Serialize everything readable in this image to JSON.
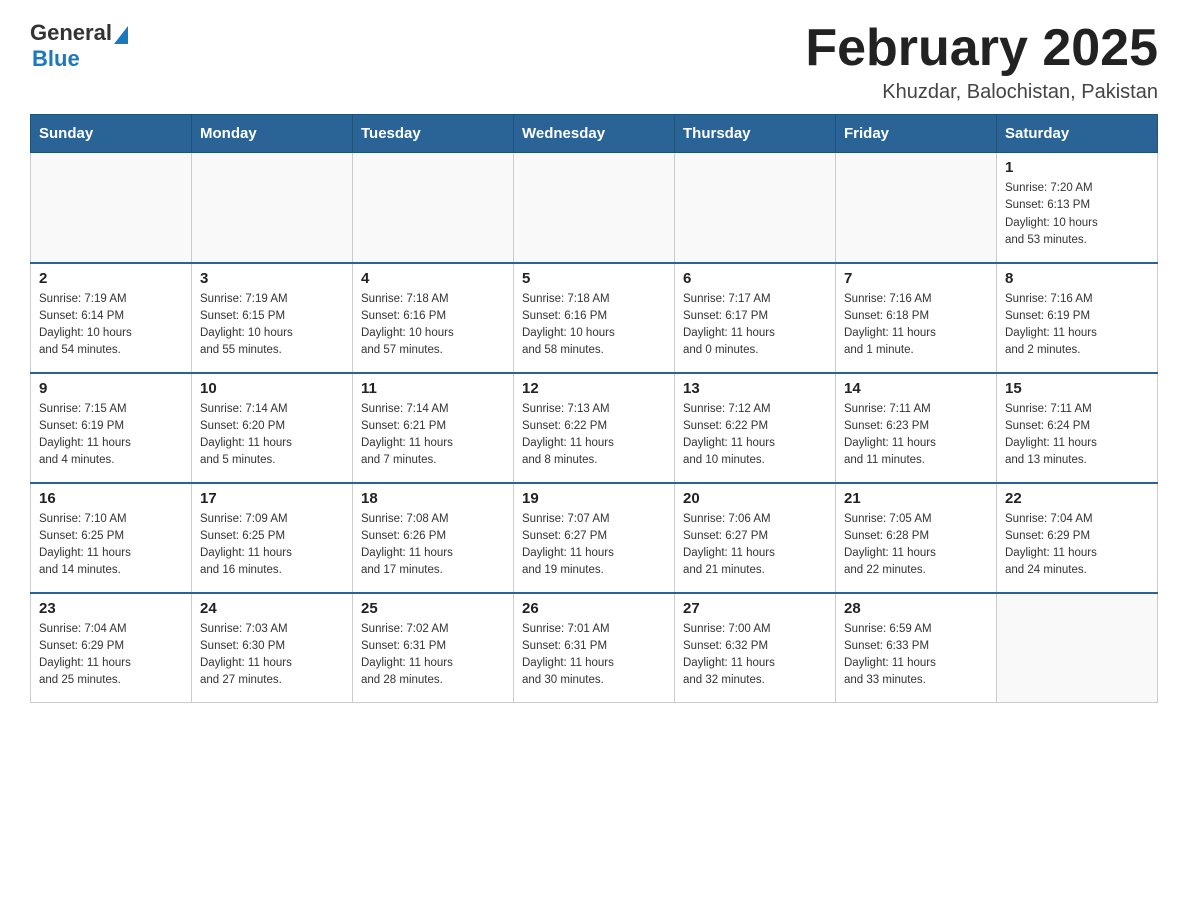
{
  "logo": {
    "general": "General",
    "triangle": "▶",
    "blue": "Blue"
  },
  "header": {
    "title": "February 2025",
    "location": "Khuzdar, Balochistan, Pakistan"
  },
  "weekdays": [
    "Sunday",
    "Monday",
    "Tuesday",
    "Wednesday",
    "Thursday",
    "Friday",
    "Saturday"
  ],
  "weeks": [
    [
      {
        "day": "",
        "info": ""
      },
      {
        "day": "",
        "info": ""
      },
      {
        "day": "",
        "info": ""
      },
      {
        "day": "",
        "info": ""
      },
      {
        "day": "",
        "info": ""
      },
      {
        "day": "",
        "info": ""
      },
      {
        "day": "1",
        "info": "Sunrise: 7:20 AM\nSunset: 6:13 PM\nDaylight: 10 hours\nand 53 minutes."
      }
    ],
    [
      {
        "day": "2",
        "info": "Sunrise: 7:19 AM\nSunset: 6:14 PM\nDaylight: 10 hours\nand 54 minutes."
      },
      {
        "day": "3",
        "info": "Sunrise: 7:19 AM\nSunset: 6:15 PM\nDaylight: 10 hours\nand 55 minutes."
      },
      {
        "day": "4",
        "info": "Sunrise: 7:18 AM\nSunset: 6:16 PM\nDaylight: 10 hours\nand 57 minutes."
      },
      {
        "day": "5",
        "info": "Sunrise: 7:18 AM\nSunset: 6:16 PM\nDaylight: 10 hours\nand 58 minutes."
      },
      {
        "day": "6",
        "info": "Sunrise: 7:17 AM\nSunset: 6:17 PM\nDaylight: 11 hours\nand 0 minutes."
      },
      {
        "day": "7",
        "info": "Sunrise: 7:16 AM\nSunset: 6:18 PM\nDaylight: 11 hours\nand 1 minute."
      },
      {
        "day": "8",
        "info": "Sunrise: 7:16 AM\nSunset: 6:19 PM\nDaylight: 11 hours\nand 2 minutes."
      }
    ],
    [
      {
        "day": "9",
        "info": "Sunrise: 7:15 AM\nSunset: 6:19 PM\nDaylight: 11 hours\nand 4 minutes."
      },
      {
        "day": "10",
        "info": "Sunrise: 7:14 AM\nSunset: 6:20 PM\nDaylight: 11 hours\nand 5 minutes."
      },
      {
        "day": "11",
        "info": "Sunrise: 7:14 AM\nSunset: 6:21 PM\nDaylight: 11 hours\nand 7 minutes."
      },
      {
        "day": "12",
        "info": "Sunrise: 7:13 AM\nSunset: 6:22 PM\nDaylight: 11 hours\nand 8 minutes."
      },
      {
        "day": "13",
        "info": "Sunrise: 7:12 AM\nSunset: 6:22 PM\nDaylight: 11 hours\nand 10 minutes."
      },
      {
        "day": "14",
        "info": "Sunrise: 7:11 AM\nSunset: 6:23 PM\nDaylight: 11 hours\nand 11 minutes."
      },
      {
        "day": "15",
        "info": "Sunrise: 7:11 AM\nSunset: 6:24 PM\nDaylight: 11 hours\nand 13 minutes."
      }
    ],
    [
      {
        "day": "16",
        "info": "Sunrise: 7:10 AM\nSunset: 6:25 PM\nDaylight: 11 hours\nand 14 minutes."
      },
      {
        "day": "17",
        "info": "Sunrise: 7:09 AM\nSunset: 6:25 PM\nDaylight: 11 hours\nand 16 minutes."
      },
      {
        "day": "18",
        "info": "Sunrise: 7:08 AM\nSunset: 6:26 PM\nDaylight: 11 hours\nand 17 minutes."
      },
      {
        "day": "19",
        "info": "Sunrise: 7:07 AM\nSunset: 6:27 PM\nDaylight: 11 hours\nand 19 minutes."
      },
      {
        "day": "20",
        "info": "Sunrise: 7:06 AM\nSunset: 6:27 PM\nDaylight: 11 hours\nand 21 minutes."
      },
      {
        "day": "21",
        "info": "Sunrise: 7:05 AM\nSunset: 6:28 PM\nDaylight: 11 hours\nand 22 minutes."
      },
      {
        "day": "22",
        "info": "Sunrise: 7:04 AM\nSunset: 6:29 PM\nDaylight: 11 hours\nand 24 minutes."
      }
    ],
    [
      {
        "day": "23",
        "info": "Sunrise: 7:04 AM\nSunset: 6:29 PM\nDaylight: 11 hours\nand 25 minutes."
      },
      {
        "day": "24",
        "info": "Sunrise: 7:03 AM\nSunset: 6:30 PM\nDaylight: 11 hours\nand 27 minutes."
      },
      {
        "day": "25",
        "info": "Sunrise: 7:02 AM\nSunset: 6:31 PM\nDaylight: 11 hours\nand 28 minutes."
      },
      {
        "day": "26",
        "info": "Sunrise: 7:01 AM\nSunset: 6:31 PM\nDaylight: 11 hours\nand 30 minutes."
      },
      {
        "day": "27",
        "info": "Sunrise: 7:00 AM\nSunset: 6:32 PM\nDaylight: 11 hours\nand 32 minutes."
      },
      {
        "day": "28",
        "info": "Sunrise: 6:59 AM\nSunset: 6:33 PM\nDaylight: 11 hours\nand 33 minutes."
      },
      {
        "day": "",
        "info": ""
      }
    ]
  ]
}
